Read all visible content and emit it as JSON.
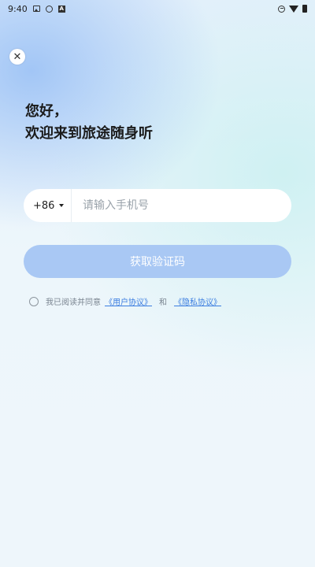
{
  "status_bar": {
    "time": "9:40",
    "left_icons": [
      "image-icon",
      "globe-icon",
      "a-icon"
    ],
    "right_icons": [
      "do-not-disturb-icon",
      "wifi-icon",
      "battery-icon"
    ]
  },
  "close_button": {
    "glyph": "✕"
  },
  "greeting": {
    "line1": "您好，",
    "line2": "欢迎来到旅途随身听"
  },
  "phone_form": {
    "country_code": "+86",
    "phone_placeholder": "请输入手机号",
    "phone_value": ""
  },
  "get_code_button": {
    "label": "获取验证码",
    "enabled": false,
    "color": "#a9c8f4"
  },
  "agreement": {
    "checked": false,
    "prefix": "我已阅读并同意",
    "user_agreement": "《用户协议》",
    "and": "和",
    "privacy_policy": "《隐私协议》",
    "link_color": "#3b7de0"
  }
}
